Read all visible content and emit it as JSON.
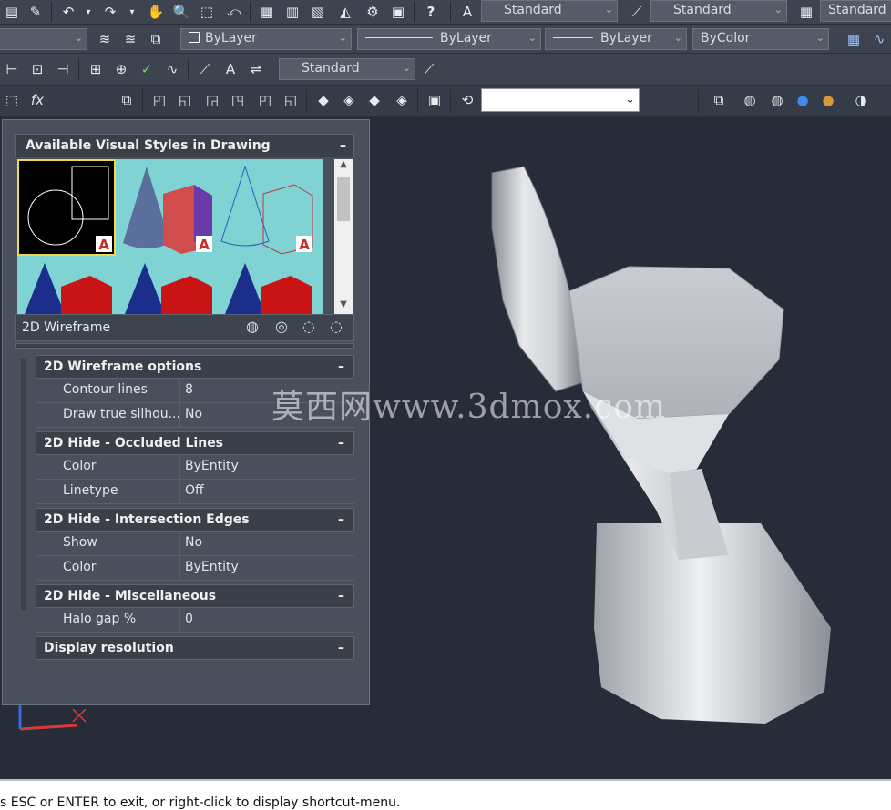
{
  "toolbar1": {
    "text_style": "Standard",
    "dim_style": "Standard",
    "table_style": "Standard"
  },
  "toolbar2": {
    "color": "ByLayer",
    "linetype": "ByLayer",
    "lineweight": "ByLayer",
    "plot_style": "ByColor"
  },
  "toolbar3": {
    "dim_style2": "Standard"
  },
  "panel": {
    "header": "Available Visual Styles in Drawing",
    "current_style": "2D Wireframe",
    "groups": [
      {
        "title": "2D Wireframe options",
        "rows": [
          {
            "k": "Contour lines",
            "v": "8"
          },
          {
            "k": "Draw true silhou...",
            "v": "No"
          }
        ]
      },
      {
        "title": "2D Hide - Occluded Lines",
        "rows": [
          {
            "k": "Color",
            "v": "ByEntity"
          },
          {
            "k": "Linetype",
            "v": "Off"
          }
        ]
      },
      {
        "title": "2D Hide - Intersection Edges",
        "rows": [
          {
            "k": "Show",
            "v": "No"
          },
          {
            "k": "Color",
            "v": "ByEntity"
          }
        ]
      },
      {
        "title": "2D Hide - Miscellaneous",
        "rows": [
          {
            "k": "Halo gap %",
            "v": "0"
          }
        ]
      },
      {
        "title": "Display resolution",
        "rows": []
      }
    ]
  },
  "watermark": "莫西网www.3dmox.com",
  "command_line": "s ESC or ENTER to exit, or right-click to display shortcut-menu."
}
